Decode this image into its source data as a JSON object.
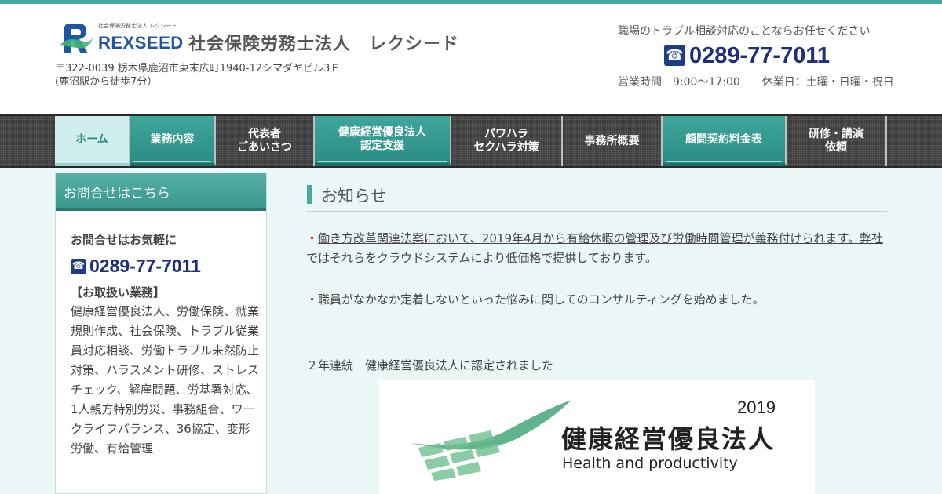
{
  "header": {
    "logo": {
      "small_text": "社会保険労務士法人 レクシード",
      "name": "REXSEED"
    },
    "title": "社会保険労務士法人　レクシード",
    "address_line1": "〒322-0039 栃木県鹿沼市東末広町1940-12シマダヤビル3Ｆ",
    "address_line2": "(鹿沼駅から徒歩7分）",
    "tagline": "職場のトラブル相談対応のことならお任せください",
    "phone": "0289-77-7011",
    "hours": "営業時間　9:00～17:00　　休業日：土曜・日曜・祝日"
  },
  "nav": {
    "items": [
      {
        "label": "ホーム"
      },
      {
        "label": "業務内容"
      },
      {
        "label": "代表者\nごあいさつ"
      },
      {
        "label": "健康経営優良法人\n認定支援"
      },
      {
        "label": "パワハラ\nセクハラ対策"
      },
      {
        "label": "事務所概要"
      },
      {
        "label": "顧問契約料金表"
      },
      {
        "label": "研修・講演\n依頼"
      }
    ]
  },
  "sidebar": {
    "heading": "お問合せはこちら",
    "lead": "お問合せはお気軽に",
    "phone": "0289-77-7011",
    "services_title": "【お取扱い業務】",
    "services_text": "健康経営優良法人、労働保険、就業規則作成、社会保険、トラブル従業員対応相談、労働トラブル未然防止対策、ハラスメント研修、ストレスチェック、解雇問題、労基署対応、1人親方特別労災、事務組合、ワークライフバランス、36協定、変形労働、有給管理"
  },
  "main": {
    "heading": "お知らせ",
    "news": [
      {
        "bullet": "・",
        "text": "働き方改革関連法案において、2019年4月から有給休暇の管理及び労働時間管理が義務付けられます。弊社ではそれらをクラウドシステムにより低価格で提供しております。"
      },
      {
        "bullet": "・",
        "text": "職員がなかなか定着しないといった悩みに関してのコンサルティングを始めました。"
      }
    ],
    "cert_text": "２年連続　健康経営優良法人に認定されました",
    "cert_image": {
      "year": "2019",
      "title": "健康経営優良法人",
      "subtitle": "Health and productivity"
    }
  },
  "colors": {
    "accent_teal": "#45a99b",
    "phone_navy": "#1d2f7a",
    "logo_blue": "#1f56a4",
    "content_bg": "#eaf7f6"
  },
  "icons": [
    "rexseed-logo-icon",
    "phone-icon",
    "health-productivity-logo-icon"
  ]
}
